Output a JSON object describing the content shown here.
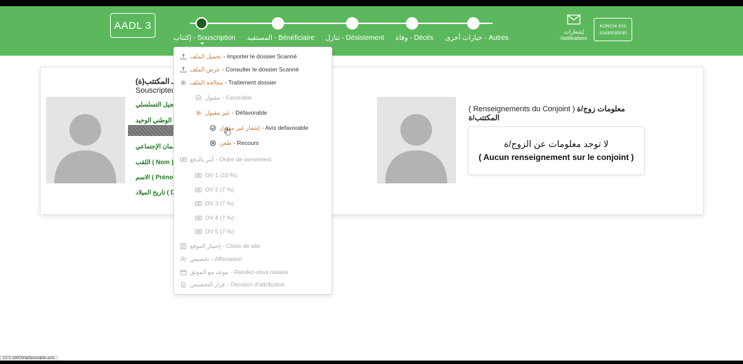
{
  "brand": "AADL 3",
  "steps": [
    {
      "label": "إكتتاب - Souscription",
      "active": true
    },
    {
      "label": "المستفيد - Bénéficiaire",
      "active": false
    },
    {
      "label": "تنازل - Désistement",
      "active": false
    },
    {
      "label": "وفاة - Décès",
      "active": false
    },
    {
      "label": "خيارات أخرى - Autres",
      "active": false
    }
  ],
  "notifications": {
    "label_ar": "إشعارات",
    "label_fr": "Notifications",
    "icon": "envelope-icon"
  },
  "user": {
    "name": "KORCHI AYA",
    "id": "31630030030"
  },
  "subscriber": {
    "title_ar": "ـ المكتتب(ة)",
    "title_fr": "Souscripteu",
    "fields": [
      "سجيل التسلسلي",
      "الوطني الوحيد",
      "ضمان الإجتماعي",
      "اللقب ( Nom )",
      "الاسم ( Préno",
      "تاريخ الميلاد ( D"
    ]
  },
  "conjoint": {
    "title_ar": "معلومات زوج/ة المكتتب/ة",
    "title_fr": "( Renseignements du Conjoint )",
    "empty_ar": "لا توجد معلومات عن الزوج/ة",
    "empty_fr": "( Aucun renseignement sur le conjoint )"
  },
  "dropdown": {
    "items": [
      {
        "ar": "تحميل الملف",
        "fr": "- Importer le dossier Scanné",
        "icon": "upload-icon",
        "disabled": false,
        "ar_color": "orange"
      },
      {
        "ar": "عرض الملف",
        "fr": "- Consulter le dossier Scanné",
        "icon": "upload-icon",
        "disabled": false,
        "ar_color": "orange"
      },
      {
        "ar": "معالجة الملف",
        "fr": "- Traitement dossier",
        "icon": "gear-icon",
        "disabled": false,
        "ar_color": "orange"
      },
      {
        "ar": "مقبول",
        "fr": "- Favorable",
        "icon": "check-circle-icon",
        "disabled": true
      },
      {
        "ar": "غير مقبول",
        "fr": "- Défavorable",
        "icon": "gear-icon",
        "disabled": false,
        "ar_color": "orange"
      },
      {
        "ar": "إشعار غير مقبول",
        "fr": "- Avis defavorable",
        "icon": "check-circle-icon",
        "disabled": false,
        "ar_color": "orange"
      },
      {
        "ar": "طعن",
        "fr": "- Recours",
        "icon": "x-circle-icon",
        "disabled": false,
        "ar_color": "orange"
      },
      {
        "ar": "أمر بالدفع",
        "fr": "- Ordre de versement",
        "icon": "payment-icon",
        "disabled": true
      },
      {
        "ar": "",
        "fr": "OV 1 (10 %)",
        "icon": "payment-icon",
        "disabled": true
      },
      {
        "ar": "",
        "fr": "OV 2 (7 %)",
        "icon": "payment-icon",
        "disabled": true
      },
      {
        "ar": "",
        "fr": "OV 3 (7 %)",
        "icon": "payment-icon",
        "disabled": true
      },
      {
        "ar": "",
        "fr": "OV 4 (7 %)",
        "icon": "payment-icon",
        "disabled": true
      },
      {
        "ar": "",
        "fr": "OV 5 (7 %)",
        "icon": "payment-icon",
        "disabled": true
      },
      {
        "ar": "إختيار الموقع",
        "fr": "- Choix de site",
        "icon": "building-icon",
        "disabled": true
      },
      {
        "ar": "تخصيص",
        "fr": "- Affectation",
        "icon": "user-assign-icon",
        "disabled": true
      },
      {
        "ar": "موعد مع الموثق",
        "fr": "- Rendez-vous notaire",
        "icon": "calendar-icon",
        "disabled": true
      },
      {
        "ar": "قرار التخصيص",
        "fr": "- Decision d'attribution",
        "icon": "document-icon",
        "disabled": true
      }
    ]
  },
  "status_url": "10.0.18000/defavorable-avis"
}
